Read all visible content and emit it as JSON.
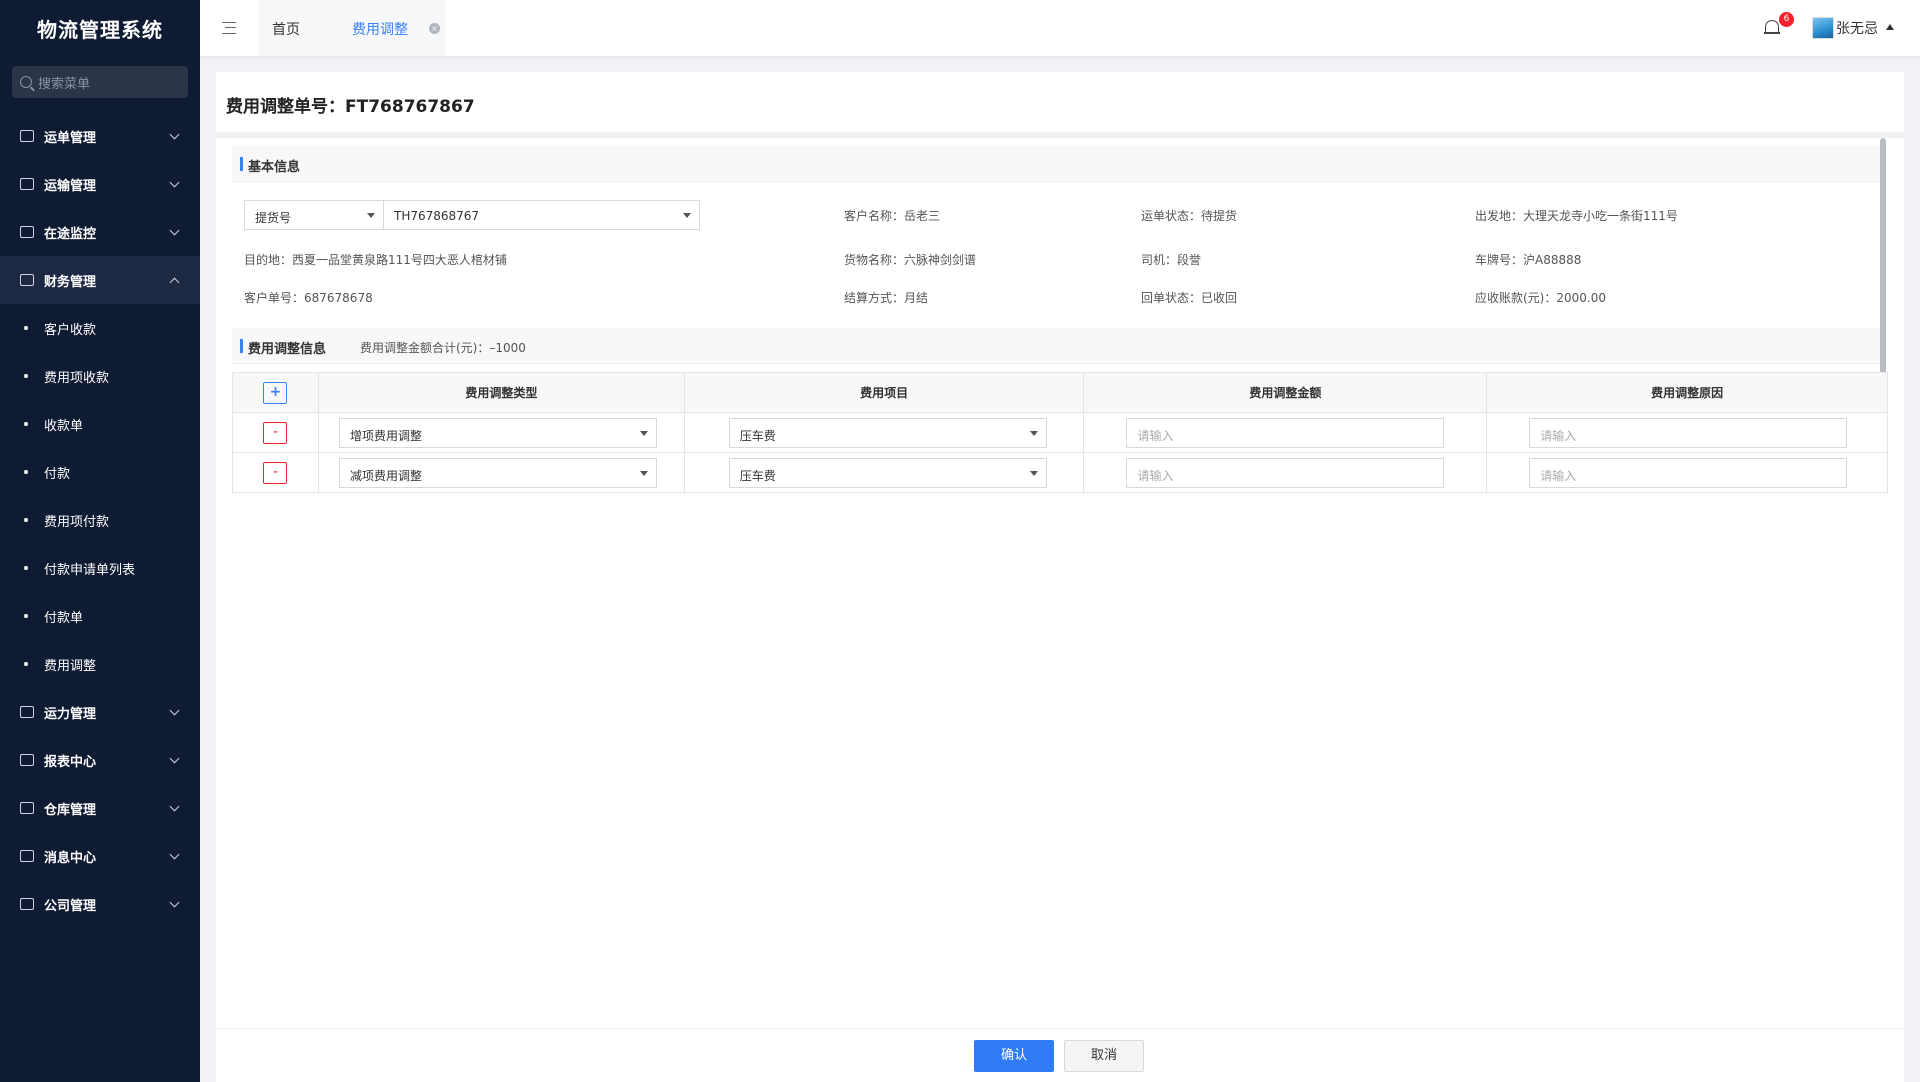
{
  "app": {
    "title": "物流管理系统"
  },
  "search": {
    "placeholder": "搜索菜单"
  },
  "sidebar": {
    "items": [
      {
        "label": "运单管理"
      },
      {
        "label": "运输管理"
      },
      {
        "label": "在途监控"
      },
      {
        "label": "财务管理"
      },
      {
        "label": "运力管理"
      },
      {
        "label": "报表中心"
      },
      {
        "label": "仓库管理"
      },
      {
        "label": "消息中心"
      },
      {
        "label": "公司管理"
      }
    ],
    "finance_sub": [
      {
        "label": "客户收款"
      },
      {
        "label": "费用项收款"
      },
      {
        "label": "收款单"
      },
      {
        "label": "付款"
      },
      {
        "label": "费用项付款"
      },
      {
        "label": "付款申请单列表"
      },
      {
        "label": "付款单"
      },
      {
        "label": "费用调整"
      }
    ]
  },
  "header": {
    "tabs": [
      {
        "label": "首页"
      },
      {
        "label": "费用调整"
      }
    ],
    "notification_count": "6",
    "user_name": "张无忌"
  },
  "page": {
    "title": "费用调整单号：FT768767867"
  },
  "basic": {
    "section_title": "基本信息",
    "pickup_type": "提货号",
    "pickup_no": "TH767868767",
    "customer_name": "客户名称：岳老三",
    "waybill_status": "运单状态：待提货",
    "origin": "出发地：大理天龙寺小吃一条街111号",
    "destination": "目的地：西夏一品堂黄泉路111号四大恶人棺材铺",
    "goods_name": "货物名称：六脉神剑剑谱",
    "driver": "司机：段誉",
    "plate": "车牌号：沪A88888",
    "customer_order": "客户单号：687678678",
    "settlement": "结算方式：月结",
    "receipt_status": "回单状态：已收回",
    "receivable": "应收账款(元)：2000.00"
  },
  "adjust": {
    "section_title": "费用调整信息",
    "total": "费用调整金额合计(元)：–1000",
    "headers": [
      "+",
      "费用调整类型",
      "费用项目",
      "费用调整金额",
      "费用调整原因"
    ],
    "rows": [
      {
        "action": "-",
        "type": "增项费用调整",
        "item": "压车费",
        "amount_placeholder": "请输入",
        "reason_placeholder": "请输入"
      },
      {
        "action": "-",
        "type": "减项费用调整",
        "item": "压车费",
        "amount_placeholder": "请输入",
        "reason_placeholder": "请输入"
      }
    ]
  },
  "footer": {
    "confirm": "确认",
    "cancel": "取消"
  },
  "colors": {
    "sidebar_bg": "#0f1b33",
    "accent": "#2f7cf6",
    "danger": "#f5222d"
  }
}
